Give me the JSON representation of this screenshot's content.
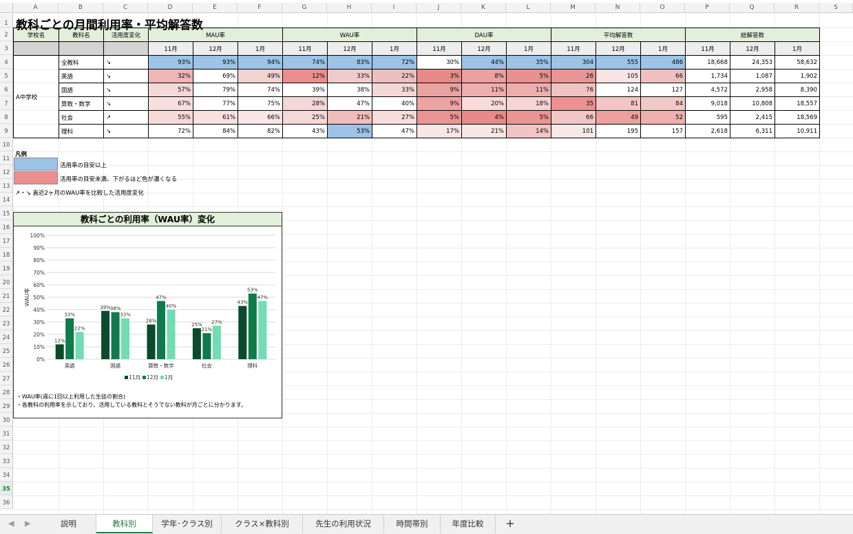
{
  "columns": [
    "A",
    "B",
    "C",
    "D",
    "E",
    "F",
    "G",
    "H",
    "I",
    "J",
    "K",
    "L",
    "M",
    "N",
    "O",
    "P",
    "Q",
    "R",
    "S"
  ],
  "rows": [
    "1",
    "2",
    "3",
    "4",
    "5",
    "6",
    "7",
    "8",
    "9",
    "10",
    "11",
    "12",
    "13",
    "14",
    "15",
    "16",
    "17",
    "18",
    "19",
    "20",
    "21",
    "22",
    "23",
    "24",
    "25",
    "26",
    "27",
    "28",
    "29",
    "30",
    "31",
    "32",
    "33",
    "34",
    "35",
    "36"
  ],
  "selected_row": "35",
  "title": "教科ごとの月間利用率・平均解答数",
  "table": {
    "header": {
      "school": "学校名",
      "subject": "教科名",
      "change": "活用度変化",
      "groups": [
        "MAU率",
        "WAU率",
        "DAU率",
        "平均解答数",
        "総解答数"
      ],
      "months": [
        "11月",
        "12月",
        "1月"
      ]
    },
    "school_name": "A中学校",
    "rows": [
      {
        "subject": "全教科",
        "trend": "↘",
        "values": [
          "93%",
          "93%",
          "94%",
          "74%",
          "83%",
          "72%",
          "30%",
          "44%",
          "35%",
          "304",
          "555",
          "486",
          "18,668",
          "24,353",
          "58,632"
        ]
      },
      {
        "subject": "英語",
        "trend": "↘",
        "values": [
          "32%",
          "69%",
          "49%",
          "12%",
          "33%",
          "22%",
          "3%",
          "8%",
          "5%",
          "26",
          "105",
          "66",
          "1,734",
          "1,087",
          "1,902"
        ]
      },
      {
        "subject": "国語",
        "trend": "↘",
        "values": [
          "57%",
          "79%",
          "74%",
          "39%",
          "38%",
          "33%",
          "9%",
          "11%",
          "11%",
          "76",
          "124",
          "127",
          "4,572",
          "2,958",
          "8,390"
        ]
      },
      {
        "subject": "算数・数学",
        "trend": "↘",
        "values": [
          "67%",
          "77%",
          "75%",
          "28%",
          "47%",
          "40%",
          "9%",
          "20%",
          "18%",
          "35",
          "81",
          "84",
          "9,018",
          "10,808",
          "18,557"
        ]
      },
      {
        "subject": "社会",
        "trend": "↗",
        "values": [
          "55%",
          "61%",
          "66%",
          "25%",
          "21%",
          "27%",
          "5%",
          "4%",
          "5%",
          "66",
          "49",
          "52",
          "595",
          "2,415",
          "18,569"
        ]
      },
      {
        "subject": "理科",
        "trend": "↘",
        "values": [
          "72%",
          "84%",
          "82%",
          "43%",
          "53%",
          "47%",
          "17%",
          "21%",
          "14%",
          "101",
          "195",
          "157",
          "2,618",
          "6,311",
          "10,911"
        ]
      }
    ],
    "fills": [
      [
        "#9dc3e6",
        "#9dc3e6",
        "#9dc3e6",
        "#9dc3e6",
        "#9dc3e6",
        "#9dc3e6",
        "#ffffff",
        "#9dc3e6",
        "#9dc3e6",
        "#9dc3e6",
        "#9dc3e6",
        "#9dc3e6",
        "#ffffff",
        "#ffffff",
        "#ffffff"
      ],
      [
        "#eeb6b6",
        "#ffffff",
        "#f3d2d2",
        "#ec8e8e",
        "#f0cbcb",
        "#edc0c0",
        "#e88a8a",
        "#eca1a1",
        "#e99191",
        "#e99595",
        "#f8e4e4",
        "#f0c0c0",
        "#ffffff",
        "#ffffff",
        "#ffffff"
      ],
      [
        "#f5d9d9",
        "#ffffff",
        "#ffffff",
        "#ffffff",
        "#ffffff",
        "#f3d8d8",
        "#eba2a2",
        "#efaeae",
        "#efaeae",
        "#f1c3c3",
        "#ffffff",
        "#ffffff",
        "#ffffff",
        "#ffffff",
        "#ffffff"
      ],
      [
        "#f7dfdf",
        "#ffffff",
        "#ffffff",
        "#f4d7d7",
        "#ffffff",
        "#ffffff",
        "#eba3a3",
        "#f7dcdc",
        "#f5d4d4",
        "#ec9090",
        "#f2c6c6",
        "#f2c9c9",
        "#ffffff",
        "#ffffff",
        "#ffffff"
      ],
      [
        "#f6dada",
        "#f8e1e1",
        "#f9e6e6",
        "#f5d8d8",
        "#f0bcbc",
        "#f7dddd",
        "#eb9494",
        "#e88a8a",
        "#eb9494",
        "#f2c6c6",
        "#ee9f9f",
        "#efb0b0",
        "#ffffff",
        "#ffffff",
        "#ffffff"
      ],
      [
        "#ffffff",
        "#ffffff",
        "#ffffff",
        "#ffffff",
        "#9dc3e6",
        "#ffffff",
        "#f9e6e6",
        "#f9e6e6",
        "#f2c4c4",
        "#f9e8e8",
        "#ffffff",
        "#ffffff",
        "#ffffff",
        "#ffffff",
        "#ffffff"
      ]
    ]
  },
  "legend": {
    "heading": "凡例",
    "blue_color": "#9dc3e6",
    "red_color": "#ec8e8e",
    "blue_text": "活用率の目安以上",
    "red_text": "活用率の目安未満、下がるほど色が濃くなる",
    "arrow_text": "↗・↘  直近2ヶ月のWAU率を比較した活用度変化"
  },
  "chart": {
    "title": "教科ごとの利用率（WAU率）変化",
    "notes": [
      "・WAU率(週に1回以上利用した生徒の割合)",
      "・各教科の利用率を示しており、活用している教科とそうでない教科が月ごとに分かります。"
    ]
  },
  "chart_data": {
    "type": "bar",
    "title": "教科ごとの利用率（WAU率）変化",
    "categories": [
      "英語",
      "国語",
      "算数・数学",
      "社会",
      "理科"
    ],
    "series": [
      {
        "name": "11月",
        "values": [
          12,
          39,
          28,
          25,
          43
        ],
        "color": "#0b4a2c"
      },
      {
        "name": "12月",
        "values": [
          33,
          38,
          47,
          21,
          53
        ],
        "color": "#0f7a4b"
      },
      {
        "name": "1月",
        "values": [
          22,
          33,
          40,
          27,
          47
        ],
        "color": "#72dcb3"
      }
    ],
    "data_labels": [
      [
        "12%",
        "39%",
        "28%",
        "25%",
        "43%"
      ],
      [
        "33%",
        "38%",
        "47%",
        "21%",
        "53%"
      ],
      [
        "22%",
        "33%",
        "40%",
        "27%",
        "47%"
      ]
    ],
    "ylabel": "WAU率",
    "xlabel": "",
    "yticks": [
      "0%",
      "10%",
      "20%",
      "30%",
      "40%",
      "50%",
      "60%",
      "70%",
      "80%",
      "90%",
      "100%"
    ],
    "ylim": [
      0,
      100
    ],
    "grid": true,
    "legend": "bottom"
  },
  "tabs": [
    "説明",
    "教科別",
    "学年･クラス別",
    "クラス×教科別",
    "先生の利用状況",
    "時間帯別",
    "年度比較"
  ],
  "active_tab": "教科別",
  "add_sheet": "+",
  "nav_left": "◀",
  "nav_right": "▶"
}
